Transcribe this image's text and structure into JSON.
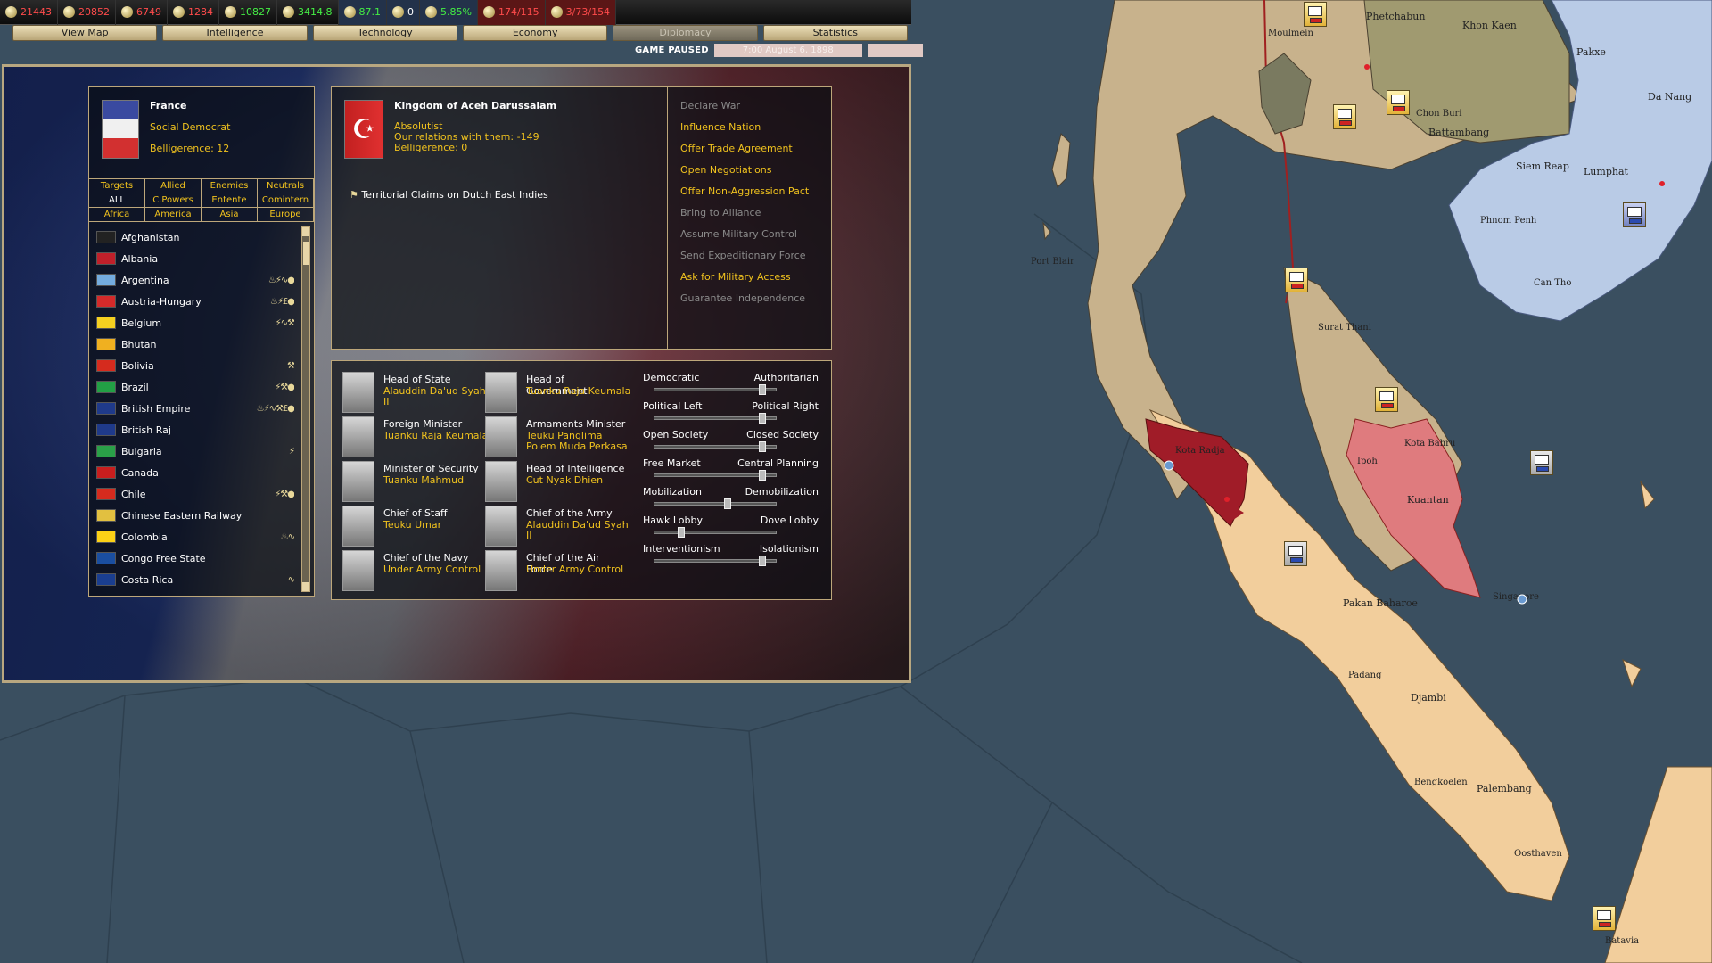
{
  "topbar": {
    "resources": [
      {
        "icon": "energy-icon",
        "value": "21443",
        "color": "#ff4b4b"
      },
      {
        "icon": "metal-icon",
        "value": "20852",
        "color": "#ff4b4b"
      },
      {
        "icon": "rare-materials-icon",
        "value": "6749",
        "color": "#ff4b4b"
      },
      {
        "icon": "crude-oil-icon",
        "value": "1284",
        "color": "#ff4b4b"
      },
      {
        "icon": "supplies-icon",
        "value": "10827",
        "color": "#44ee44"
      },
      {
        "icon": "money-icon",
        "value": "3414.8",
        "color": "#44ee44"
      },
      {
        "icon": "ic-icon",
        "value": "87.1",
        "color": "#44ee44"
      },
      {
        "icon": "diplomacy-icon",
        "value": "0",
        "color": "#ffffff"
      },
      {
        "icon": "manpower-icon",
        "value": "5.85%",
        "color": "#44ee44"
      },
      {
        "icon": "convoy-icon",
        "value": "174/115",
        "color": "#ff4b4b"
      },
      {
        "icon": "transport-icon",
        "value": "3/73/154",
        "color": "#ff4b4b"
      }
    ]
  },
  "tabs": [
    {
      "label": "View Map",
      "disabled": false
    },
    {
      "label": "Intelligence",
      "disabled": false
    },
    {
      "label": "Technology",
      "disabled": false
    },
    {
      "label": "Economy",
      "disabled": false
    },
    {
      "label": "Diplomacy",
      "disabled": true
    },
    {
      "label": "Statistics",
      "disabled": false
    }
  ],
  "status": {
    "paused": "GAME PAUSED",
    "date": "7:00 August 6, 1898"
  },
  "player": {
    "name": "France",
    "ideology": "Social Democrat",
    "belligerence": "Belligerence: 12"
  },
  "filters": [
    "Targets",
    "Allied",
    "Enemies",
    "Neutrals",
    "ALL",
    "C.Powers",
    "Entente",
    "Comintern",
    "Africa",
    "America",
    "Asia",
    "Europe"
  ],
  "countries": [
    {
      "name": "Afghanistan",
      "flag": "#222222",
      "icons": ""
    },
    {
      "name": "Albania",
      "flag": "#c0202a",
      "icons": ""
    },
    {
      "name": "Argentina",
      "flag": "#74acdf",
      "icons": "♨⚡∿●"
    },
    {
      "name": "Austria-Hungary",
      "flag": "#d42a2a",
      "icons": "♨⚡£●"
    },
    {
      "name": "Belgium",
      "flag": "#f5d020",
      "icons": "⚡∿⚒"
    },
    {
      "name": "Bhutan",
      "flag": "#f0b020",
      "icons": ""
    },
    {
      "name": "Bolivia",
      "flag": "#d52b1e",
      "icons": "⚒"
    },
    {
      "name": "Brazil",
      "flag": "#22a045",
      "icons": "⚡⚒●"
    },
    {
      "name": "British Empire",
      "flag": "#1f3a8a",
      "icons": "♨⚡∿⚒£●"
    },
    {
      "name": "British Raj",
      "flag": "#1f3a8a",
      "icons": ""
    },
    {
      "name": "Bulgaria",
      "flag": "#2aa048",
      "icons": "⚡"
    },
    {
      "name": "Canada",
      "flag": "#c81e1e",
      "icons": ""
    },
    {
      "name": "Chile",
      "flag": "#d52b1e",
      "icons": "⚡⚒●"
    },
    {
      "name": "Chinese Eastern Railway",
      "flag": "#e2c040",
      "icons": ""
    },
    {
      "name": "Colombia",
      "flag": "#fcd116",
      "icons": "♨∿"
    },
    {
      "name": "Congo Free State",
      "flag": "#1a4ea0",
      "icons": ""
    },
    {
      "name": "Costa Rica",
      "flag": "#1a3e90",
      "icons": "∿"
    }
  ],
  "target": {
    "name": "Kingdom of Aceh Darussalam",
    "ideology": "Absolutist",
    "relations": "Our relations with them: -149",
    "belligerence": "Belligerence: 0",
    "claim": "Territorial Claims on Dutch East Indies",
    "actions": [
      {
        "label": "Declare War",
        "enabled": false
      },
      {
        "label": "Influence Nation",
        "enabled": true
      },
      {
        "label": "Offer Trade Agreement",
        "enabled": true
      },
      {
        "label": "Open Negotiations",
        "enabled": true
      },
      {
        "label": "Offer Non-Aggression Pact",
        "enabled": true
      },
      {
        "label": "Bring to Alliance",
        "enabled": false
      },
      {
        "label": "Assume Military Control",
        "enabled": false
      },
      {
        "label": "Send Expeditionary Force",
        "enabled": false
      },
      {
        "label": "Ask for Military Access",
        "enabled": true
      },
      {
        "label": "Guarantee Independence",
        "enabled": false
      }
    ]
  },
  "ministers": [
    {
      "title": "Head of State",
      "name": "Alauddin Da'ud Syah II"
    },
    {
      "title": "Head of Government",
      "name": "Tuanku Raja Keumala"
    },
    {
      "title": "Foreign Minister",
      "name": "Tuanku Raja Keumala"
    },
    {
      "title": "Armaments Minister",
      "name": "Teuku Panglima Polem Muda Perkasa"
    },
    {
      "title": "Minister of Security",
      "name": "Tuanku Mahmud"
    },
    {
      "title": "Head of Intelligence",
      "name": "Cut Nyak Dhien"
    },
    {
      "title": "Chief of Staff",
      "name": "Teuku Umar"
    },
    {
      "title": "Chief of the Army",
      "name": "Alauddin Da'ud Syah II"
    },
    {
      "title": "Chief of the Navy",
      "name": "Under Army Control"
    },
    {
      "title": "Chief of the Air Force",
      "name": "Under Army Control"
    }
  ],
  "sliders": [
    {
      "left": "Democratic",
      "right": "Authoritarian",
      "position": 0.9
    },
    {
      "left": "Political Left",
      "right": "Political Right",
      "position": 0.9
    },
    {
      "left": "Open Society",
      "right": "Closed Society",
      "position": 0.9
    },
    {
      "left": "Free Market",
      "right": "Central Planning",
      "position": 0.9
    },
    {
      "left": "Mobilization",
      "right": "Demobilization",
      "position": 0.6
    },
    {
      "left": "Hawk Lobby",
      "right": "Dove Lobby",
      "position": 0.2
    },
    {
      "left": "Interventionism",
      "right": "Isolationism",
      "position": 0.9
    }
  ],
  "map": {
    "labels": [
      "Phetchabun",
      "Khon Kaen",
      "Pakxe",
      "Da Nang",
      "Battambang",
      "Siem Reap",
      "Lumphat",
      "Phnom Penh",
      "Can Tho",
      "Port Blair",
      "Kota Bahru",
      "Kuantan",
      "Ipoh",
      "Kota Radja",
      "Pakan Baharoe",
      "Djambi",
      "Palembang",
      "Oosthaven",
      "Padang",
      "Bengkoelen",
      "Surat Thani",
      "Moulmein",
      "Singapore",
      "Batavia",
      "Chon Buri"
    ]
  }
}
